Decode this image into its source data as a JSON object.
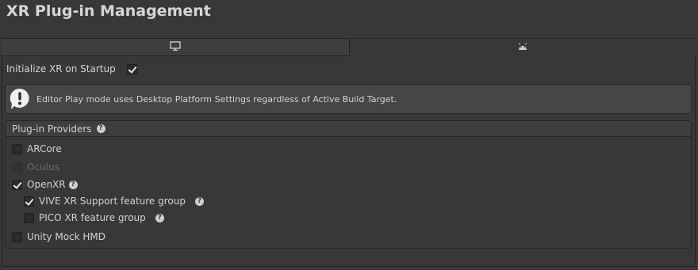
{
  "title": "XR Plug-in Management",
  "tabs": [
    {
      "icon": "monitor-icon",
      "selected": false
    },
    {
      "icon": "android-icon",
      "selected": true
    }
  ],
  "init": {
    "label": "Initialize XR on Startup",
    "checked": true
  },
  "info": {
    "message": "Editor Play mode uses Desktop Platform Settings regardless of Active Build Target."
  },
  "providers": {
    "header": "Plug-in Providers",
    "items": [
      {
        "label": "ARCore",
        "checked": false,
        "disabled": false
      },
      {
        "label": "Oculus",
        "checked": false,
        "disabled": true
      },
      {
        "label": "OpenXR",
        "checked": true,
        "disabled": false
      },
      {
        "label": "VIVE XR Support feature group",
        "checked": true,
        "disabled": false
      },
      {
        "label": "PICO XR feature group",
        "checked": false,
        "disabled": false
      },
      {
        "label": "Unity Mock HMD",
        "checked": false,
        "disabled": false
      }
    ]
  },
  "help_glyph": "?"
}
